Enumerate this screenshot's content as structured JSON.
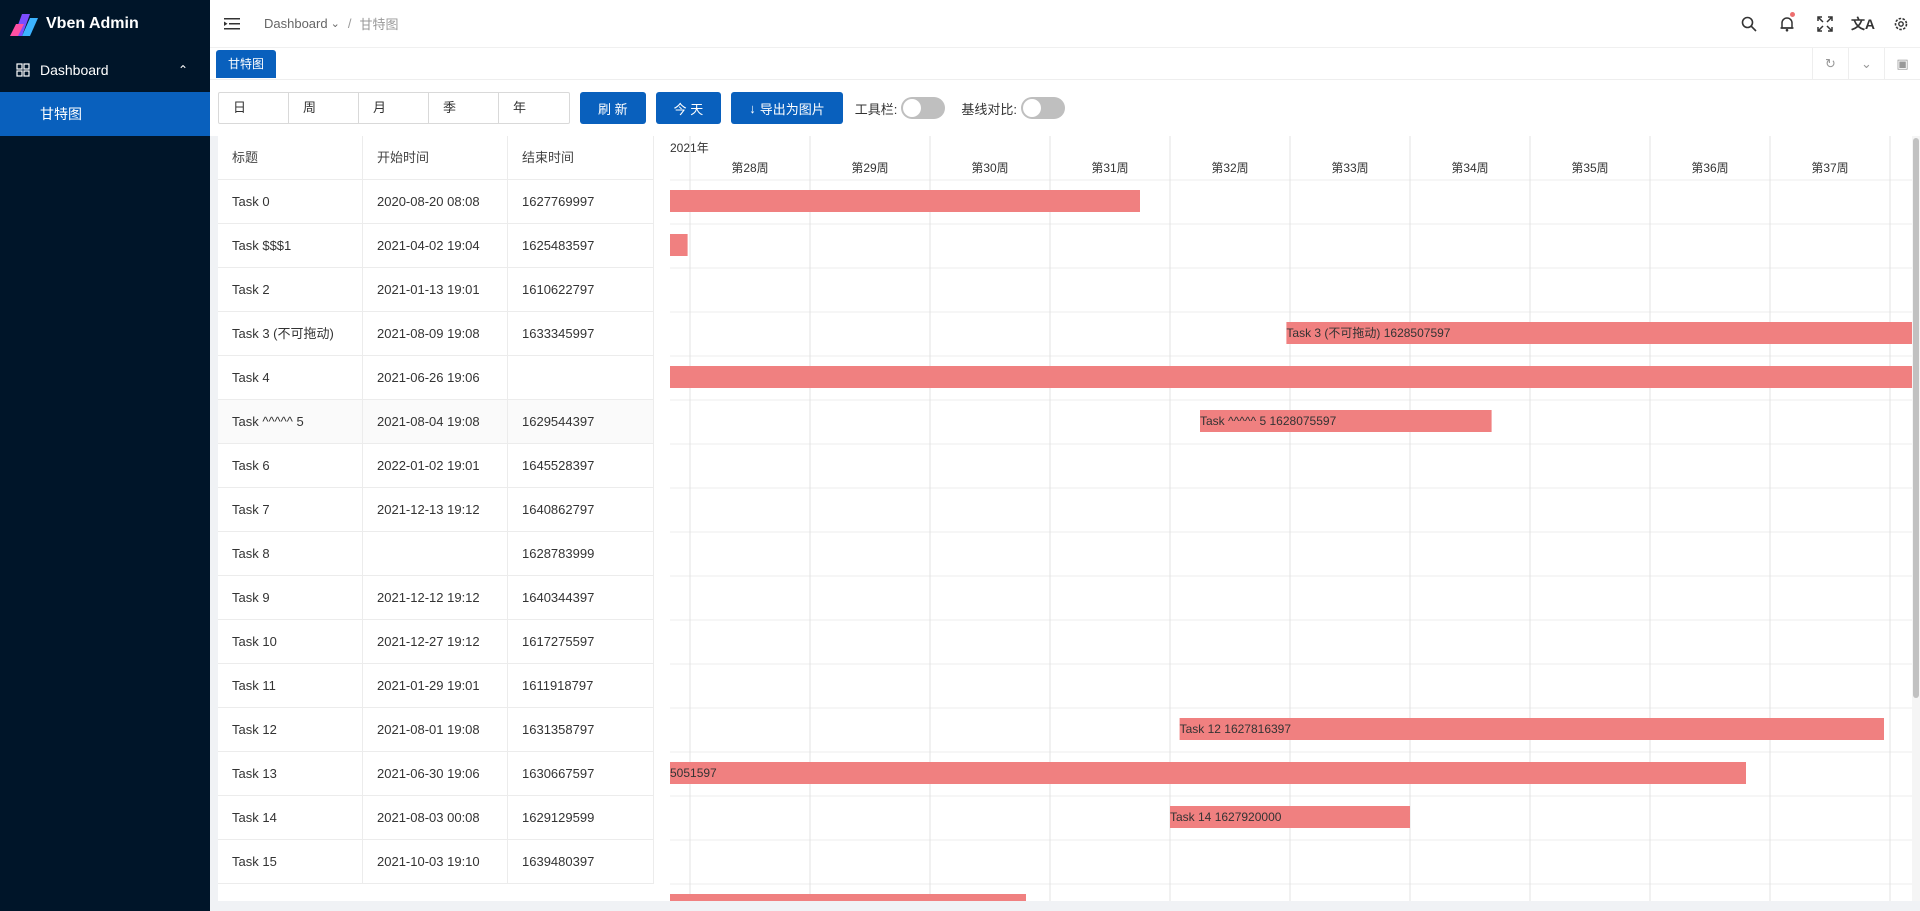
{
  "app": {
    "title": "Vben Admin"
  },
  "sidebar": {
    "menu": {
      "label": "Dashboard"
    },
    "submenu": {
      "label": "甘特图"
    }
  },
  "header": {
    "breadcrumb": {
      "root": "Dashboard",
      "sep": "/",
      "current": "甘特图"
    },
    "icons": [
      "search-icon",
      "bell-icon",
      "fullscreen-icon",
      "translate-icon",
      "gear-icon"
    ]
  },
  "tabs": [
    {
      "label": "甘特图"
    }
  ],
  "toolbar": {
    "scales": [
      "日",
      "周",
      "月",
      "季",
      "年"
    ],
    "refresh": "刷 新",
    "today": "今 天",
    "export": "导出为图片",
    "toolbar_label": "工具栏:",
    "baseline_label": "基线对比:"
  },
  "table": {
    "headers": [
      "标题",
      "开始时间",
      "结束时间"
    ],
    "rows": [
      {
        "title": "Task 0",
        "start": "2020-08-20 08:08",
        "end": "1627769997"
      },
      {
        "title": "Task $$$1",
        "start": "2021-04-02 19:04",
        "end": "1625483597"
      },
      {
        "title": "Task 2",
        "start": "2021-01-13 19:01",
        "end": "1610622797"
      },
      {
        "title": "Task 3 (不可拖动)",
        "start": "2021-08-09 19:08",
        "end": "1633345997"
      },
      {
        "title": "Task 4",
        "start": "2021-06-26 19:06",
        "end": ""
      },
      {
        "title": "Task ^^^^^ 5",
        "start": "2021-08-04 19:08",
        "end": "1629544397"
      },
      {
        "title": "Task 6",
        "start": "2022-01-02 19:01",
        "end": "1645528397"
      },
      {
        "title": "Task 7",
        "start": "2021-12-13 19:12",
        "end": "1640862797"
      },
      {
        "title": "Task 8",
        "start": "",
        "end": "1628783999"
      },
      {
        "title": "Task 9",
        "start": "2021-12-12 19:12",
        "end": "1640344397"
      },
      {
        "title": "Task 10",
        "start": "2021-12-27 19:12",
        "end": "1617275597"
      },
      {
        "title": "Task 11",
        "start": "2021-01-29 19:01",
        "end": "1611918797"
      },
      {
        "title": "Task 12",
        "start": "2021-08-01 19:08",
        "end": "1631358797"
      },
      {
        "title": "Task 13",
        "start": "2021-06-30 19:06",
        "end": "1630667597"
      },
      {
        "title": "Task 14",
        "start": "2021-08-03 00:08",
        "end": "1629129599"
      },
      {
        "title": "Task 15",
        "start": "2021-10-03 19:10",
        "end": "1639480397"
      }
    ]
  },
  "gantt": {
    "year_label": "2021年",
    "weeks": [
      "第28周",
      "第29周",
      "第30周",
      "第31周",
      "第32周",
      "第33周",
      "第34周",
      "第35周",
      "第36周",
      "第37周"
    ],
    "bar_color": "#f08080",
    "bars": [
      {
        "row": 0,
        "start_week": -0.4,
        "end_week": 3.75,
        "label": ""
      },
      {
        "row": 1,
        "start_week": -0.4,
        "end_week": -0.02,
        "label": ""
      },
      {
        "row": 3,
        "start_week": 4.97,
        "end_week": 10.2,
        "label": "Task 3 (不可拖动) 1628507597"
      },
      {
        "row": 4,
        "start_week": -0.4,
        "end_week": 10.2,
        "label": ""
      },
      {
        "row": 5,
        "start_week": 4.25,
        "end_week": 6.68,
        "label": "Task ^^^^^ 5 1628075597"
      },
      {
        "row": 12,
        "start_week": 4.08,
        "end_week": 9.95,
        "label": "Task 12 1627816397"
      },
      {
        "row": 13,
        "start_week": -0.4,
        "end_week": 8.8,
        "label": "5051597"
      },
      {
        "row": 14,
        "start_week": 4.0,
        "end_week": 6.0,
        "label": "Task 14 1627920000"
      },
      {
        "row": 16,
        "start_week": -0.4,
        "end_week": 2.8,
        "label": ""
      }
    ]
  }
}
